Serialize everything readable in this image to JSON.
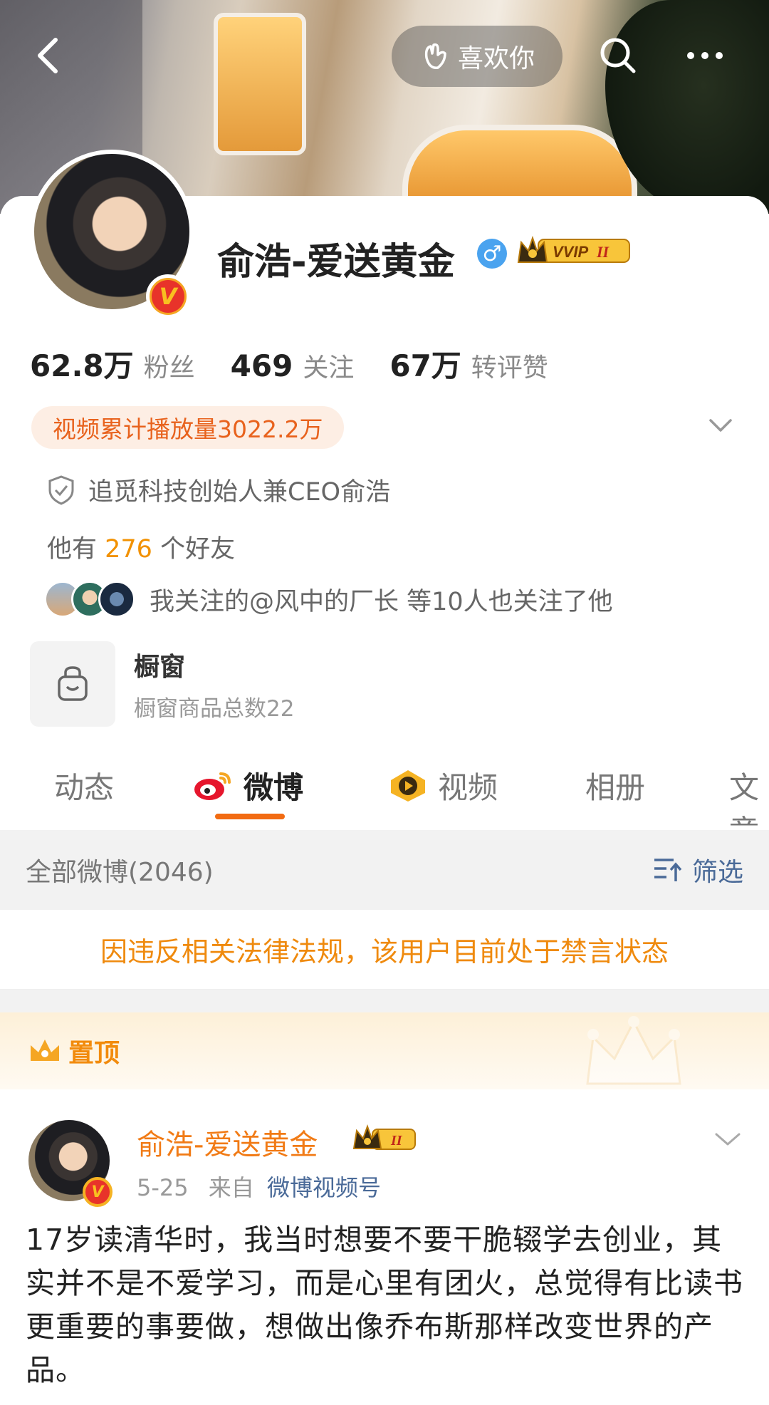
{
  "topbar": {
    "like_label": "喜欢你"
  },
  "profile": {
    "name": "俞浩-爱送黄金",
    "vip_label": "VVIP",
    "vip_level": "II",
    "verified_badge": "V"
  },
  "stats": [
    {
      "num": "62.8万",
      "label": "粉丝"
    },
    {
      "num": "469",
      "label": "关注"
    },
    {
      "num": "67万",
      "label": "转评赞"
    }
  ],
  "play_count": "视频累计播放量3022.2万",
  "certification": "追觅科技创始人兼CEO俞浩",
  "friends": {
    "prefix": "他有 ",
    "count": "276",
    "suffix": " 个好友"
  },
  "mutual_follow": "我关注的@风中的厂长 等10人也关注了他",
  "shop": {
    "title": "橱窗",
    "subtitle": "橱窗商品总数22"
  },
  "tabs": [
    "动态",
    "微博",
    "视频",
    "相册",
    "文章"
  ],
  "filter": {
    "all_label": "全部微博(2046)",
    "filter_label": "筛选"
  },
  "banned_notice": "因违反相关法律法规，该用户目前处于禁言状态",
  "pinned_label": "置顶",
  "post": {
    "author": "俞浩-爱送黄金",
    "vip_level": "II",
    "date": "5-25",
    "from_prefix": "来自",
    "source": "微博视频号",
    "content": "17岁读清华时，我当时想要不要干脆辍学去创业，其实并不是不爱学习，而是心里有团火，总觉得有比读书更重要的事要做，想做出像乔布斯那样改变世界的产品。"
  },
  "colors": {
    "accent_orange": "#f26b12",
    "link_blue": "#4a6a98",
    "gold": "#f5a623"
  }
}
